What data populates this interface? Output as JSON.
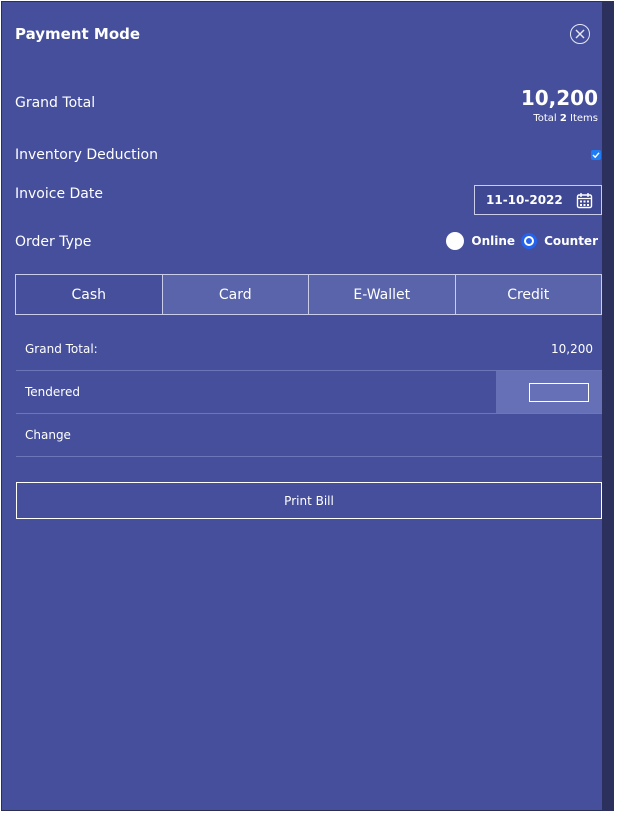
{
  "header": {
    "title": "Payment Mode",
    "close_icon": "close-circle-icon"
  },
  "grand_total": {
    "label": "Grand Total",
    "value": "10,200",
    "items_prefix": "Total",
    "items_count": "2",
    "items_suffix": "Items"
  },
  "inventory_deduction": {
    "label": "Inventory Deduction",
    "checked": true
  },
  "invoice_date": {
    "label": "Invoice Date",
    "value": "11-10-2022",
    "icon": "calendar-icon"
  },
  "order_type": {
    "label": "Order Type",
    "options": [
      {
        "label": "Online",
        "selected": false
      },
      {
        "label": "Counter",
        "selected": true
      }
    ]
  },
  "payment_tabs": [
    {
      "label": "Cash",
      "active": true
    },
    {
      "label": "Card",
      "active": false
    },
    {
      "label": "E-Wallet",
      "active": false
    },
    {
      "label": "Credit",
      "active": false
    }
  ],
  "summary": {
    "grand_total_label": "Grand Total:",
    "grand_total_value": "10,200",
    "tendered_label": "Tendered",
    "tendered_value": "",
    "change_label": "Change",
    "change_value": ""
  },
  "print_button": {
    "label": "Print Bill"
  },
  "colors": {
    "panel_bg": "#454f9c",
    "accent_blue": "#2463f0",
    "inactive_tab_bg": "#5a64aa"
  }
}
